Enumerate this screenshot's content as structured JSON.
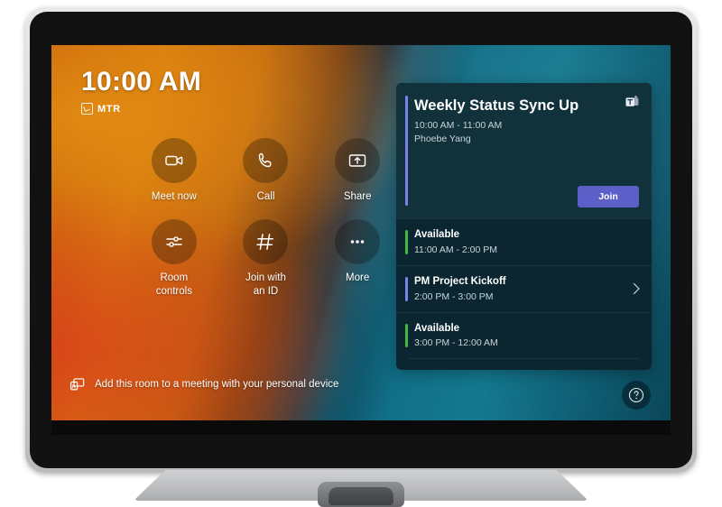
{
  "device": {
    "name": "Microsoft Teams Rooms touch console",
    "stand_icon": "hinge"
  },
  "screen": {
    "clock": {
      "time": "10:00 AM",
      "device_label": "MTR",
      "device_icon": "mtr-badge-icon"
    },
    "actions": [
      {
        "label": "Meet now",
        "icon": "video-camera-icon"
      },
      {
        "label": "Call",
        "icon": "phone-icon"
      },
      {
        "label": "Share",
        "icon": "share-screen-icon"
      },
      {
        "label": "Room\ncontrols",
        "icon": "sliders-icon"
      },
      {
        "label": "Join with\nan ID",
        "icon": "hash-icon"
      },
      {
        "label": "More",
        "icon": "ellipsis-icon"
      }
    ],
    "personal_device": {
      "label": "Add this room to a meeting with your personal device",
      "icon": "cast-icon"
    },
    "help": {
      "label": "?",
      "icon": "help-circle-icon"
    },
    "agenda": {
      "meeting": {
        "title": "Weekly Status Sync Up",
        "time": "10:00 AM - 11:00 AM",
        "organizer": "Phoebe Yang",
        "provider_icon": "microsoft-teams-icon",
        "join_label": "Join",
        "accent_color": "#7b83eb"
      },
      "items": [
        {
          "title": "Available",
          "time": "11:00 AM - 2:00 PM",
          "accent_color": "#3fbb45",
          "has_chevron": false
        },
        {
          "title": "PM Project Kickoff",
          "time": "2:00 PM - 3:00 PM",
          "accent_color": "#7b83eb",
          "has_chevron": true
        },
        {
          "title": "Available",
          "time": "3:00 PM - 12:00 AM",
          "accent_color": "#3fbb45",
          "has_chevron": false
        }
      ]
    }
  },
  "colors": {
    "join_button": "#5b5fc7",
    "available_green": "#3fbb45",
    "meeting_purple": "#7b83eb",
    "card_background": "#11313b",
    "panel_background": "#0b2630"
  }
}
